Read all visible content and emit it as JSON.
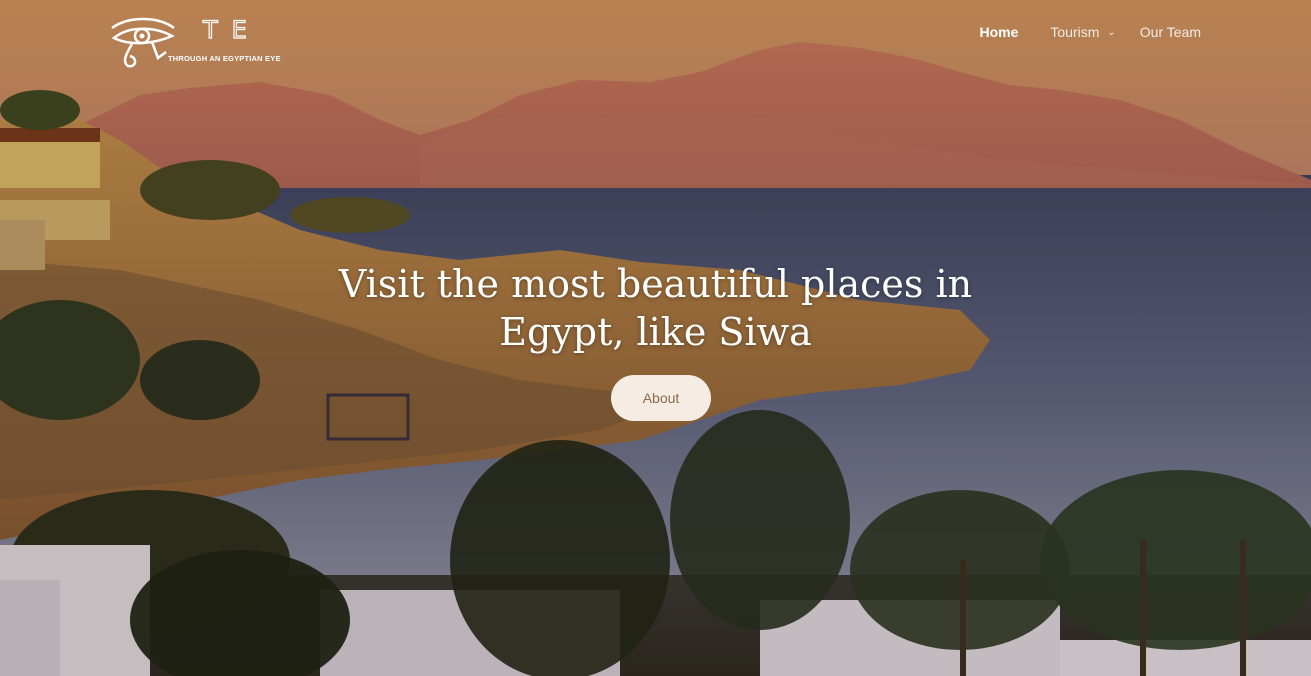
{
  "site": {
    "logo_letters": "TE",
    "logo_tagline": "THROUGH AN EGYPTIAN EYE",
    "logo_icon": "eye-of-horus-icon"
  },
  "nav": {
    "home": "Home",
    "tourism": "Tourism",
    "tourism_icon": "chevron-down-icon",
    "team": "Our Team"
  },
  "hero": {
    "headline_line1": "Visit the most beautiful places in",
    "headline_line2": "Egypt, like Siwa",
    "button_label": "About"
  },
  "colors": {
    "button_bg": "#f5ede3",
    "button_text": "#8a6a4a",
    "text": "#ffffff"
  }
}
